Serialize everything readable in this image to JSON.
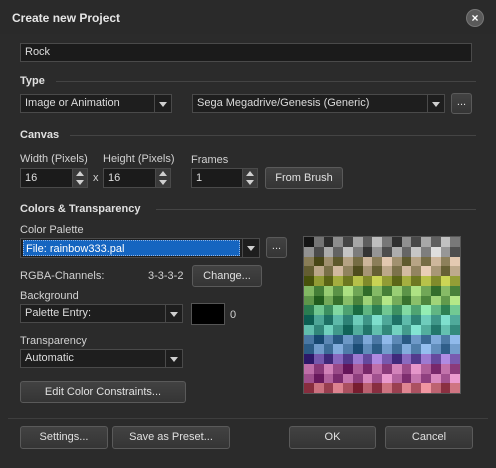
{
  "window": {
    "title": "Create new Project",
    "close_icon": "close-icon"
  },
  "project_name": "Rock",
  "type": {
    "heading": "Type",
    "kind": "Image or Animation",
    "platform": "Sega Megadrive/Genesis (Generic)",
    "browse_label": "..."
  },
  "canvas": {
    "heading": "Canvas",
    "width_label": "Width (Pixels)",
    "height_label": "Height (Pixels)",
    "frames_label": "Frames",
    "width": "16",
    "times": "x",
    "height": "16",
    "frames": "1",
    "from_brush_label": "From Brush"
  },
  "colors": {
    "heading": "Colors & Transparency",
    "palette_label": "Color Palette",
    "palette_file": "File: rainbow333.pal",
    "palette_browse": "...",
    "rgba_label": "RGBA-Channels:",
    "rgba_value": "3-3-3-2",
    "change_label": "Change...",
    "background_label": "Background",
    "background_value": "Palette Entry:",
    "background_index": "0",
    "background_swatch": "#000000",
    "transparency_label": "Transparency",
    "transparency_value": "Automatic",
    "constraints_label": "Edit Color Constraints..."
  },
  "footer": {
    "settings_label": "Settings...",
    "preset_label": "Save as Preset...",
    "ok_label": "OK",
    "cancel_label": "Cancel"
  },
  "accent_color": "#1565c0"
}
